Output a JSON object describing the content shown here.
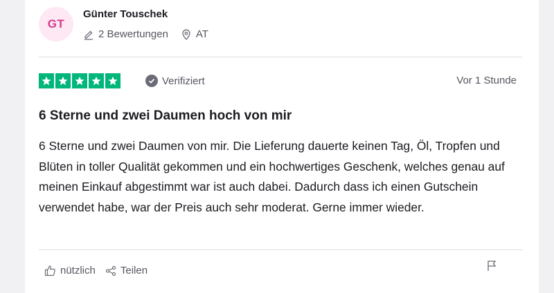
{
  "reviewer": {
    "initials": "GT",
    "name": "Günter Touschek",
    "reviews_count": "2 Bewertungen",
    "country": "AT"
  },
  "rating": {
    "stars": 5,
    "max": 5,
    "color": "#00b67a"
  },
  "verified_label": "Verifiziert",
  "time_label": "Vor 1 Stunde",
  "review": {
    "title": "6 Sterne und zwei Daumen hoch von mir",
    "text": "6 Sterne und zwei Daumen von mir. Die Lieferung dauerte keinen Tag, Öl, Tropfen und Blüten in toller Qualität gekommen und ein hochwertiges Geschenk, welches genau auf meinen Einkauf abgestimmt war ist auch dabei. Dadurch dass ich einen Gutschein verwendet habe, war der Preis auch sehr moderat. Gerne immer wieder."
  },
  "actions": {
    "useful_label": "nützlich",
    "share_label": "Teilen"
  },
  "icons": {
    "reviews": "pencil-icon",
    "location": "location-pin-icon",
    "useful": "thumbs-up-icon",
    "share": "share-icon",
    "flag": "flag-icon",
    "verified": "check-circle-icon",
    "star": "star-icon"
  }
}
